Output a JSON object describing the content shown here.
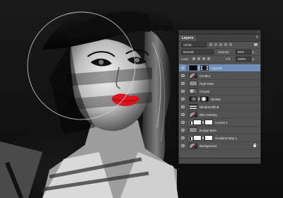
{
  "panel": {
    "title": "Layers",
    "filter_kind": "Kind",
    "blend_mode": "Normal",
    "opacity_label": "Opacity:",
    "opacity_value": "66%",
    "lock_label": "Lock:",
    "fill_label": "Fill:",
    "fill_value": "100%",
    "menu_icon": "panel-menu-icon"
  },
  "layers": [
    {
      "name": "Vignette",
      "selected": true,
      "thumb": "black",
      "mask": "vignette",
      "adjust": false
    },
    {
      "name": "Iris Blur",
      "selected": false,
      "thumb": "photo",
      "mask": null,
      "adjust": false
    },
    {
      "name": "High Pass",
      "selected": false,
      "thumb": "gray",
      "mask": null,
      "adjust": false
    },
    {
      "name": "Clouds",
      "selected": false,
      "thumb": "clouds",
      "mask": null,
      "adjust": false
    },
    {
      "name": "Smoke",
      "selected": false,
      "thumb": "smoke",
      "mask": "smoke",
      "adjust": false
    },
    {
      "name": "Window Blind",
      "selected": false,
      "thumb": "stripes",
      "mask": null,
      "adjust": false
    },
    {
      "name": "Blur Overlay",
      "selected": false,
      "thumb": "photo",
      "mask": null,
      "adjust": false
    },
    {
      "name": "Curves 1",
      "selected": false,
      "thumb": "white",
      "mask": "white",
      "adjust": true
    },
    {
      "name": "Dodge Burn",
      "selected": false,
      "thumb": "gray",
      "mask": null,
      "adjust": false
    },
    {
      "name": "Gradient Map 1",
      "selected": false,
      "thumb": "white",
      "mask": "white",
      "adjust": true
    },
    {
      "name": "Background",
      "selected": false,
      "thumb": "photo",
      "mask": null,
      "adjust": false,
      "locked": true
    }
  ],
  "colors": {
    "panel_bg": "#535353",
    "selection": "#6d8fb9",
    "lips": "#d8141f"
  }
}
